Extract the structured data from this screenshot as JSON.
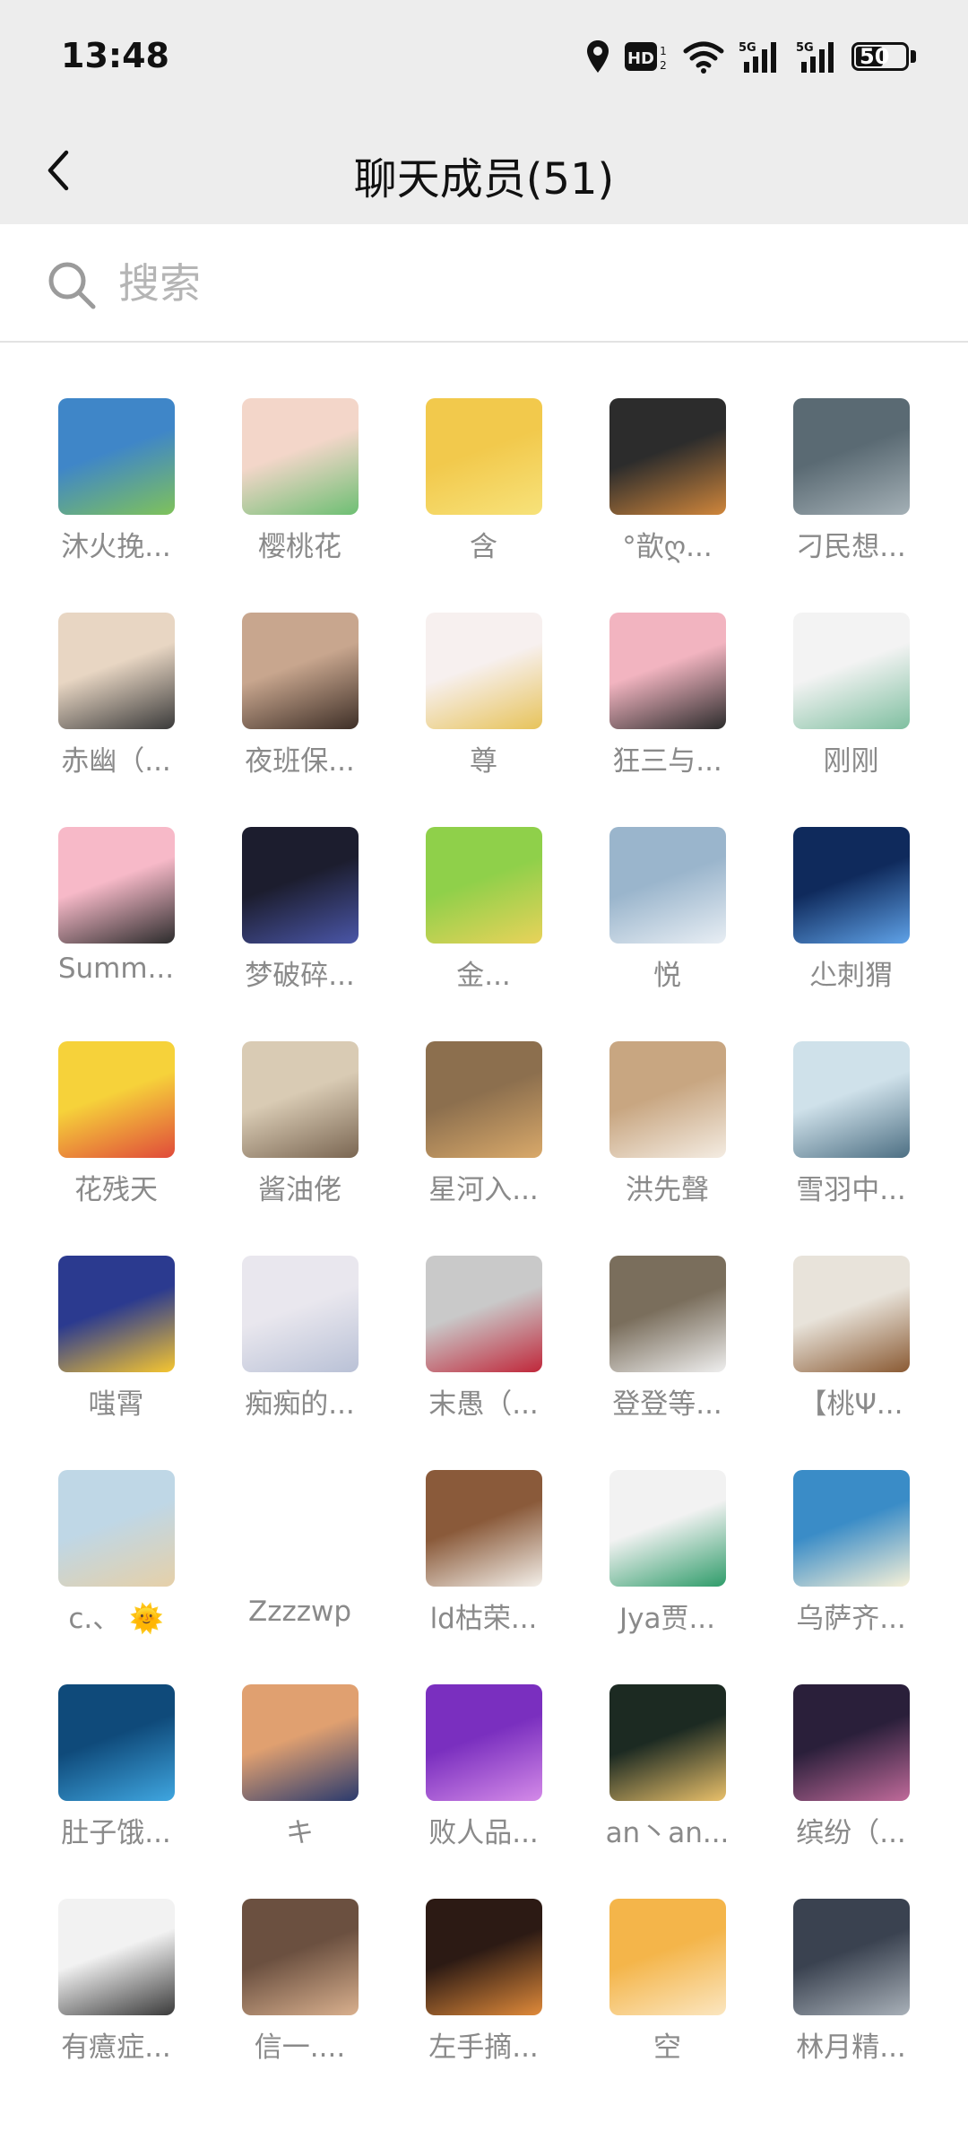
{
  "status_bar": {
    "time": "13:48",
    "battery": "50",
    "icons": [
      "location-icon",
      "hd-icon",
      "wifi-icon",
      "signal-5g-icon",
      "signal-5g-icon",
      "battery-icon"
    ]
  },
  "header": {
    "title": "聊天成员(51)",
    "back_icon": "chevron-left-icon"
  },
  "search": {
    "placeholder": "搜索",
    "value": ""
  },
  "members": [
    {
      "name": "沐火挽...",
      "colors": [
        "#3f86c8",
        "#7fc25a"
      ]
    },
    {
      "name": "樱桃花",
      "colors": [
        "#f3d6c9",
        "#6dbf73"
      ]
    },
    {
      "name": "含",
      "colors": [
        "#f2c94c",
        "#f7e27a"
      ]
    },
    {
      "name": "°歆ღ...",
      "colors": [
        "#2c2c2c",
        "#d0863b"
      ]
    },
    {
      "name": "刁民想...",
      "colors": [
        "#5a6a73",
        "#a4b0b6"
      ]
    },
    {
      "name": "赤幽（...",
      "colors": [
        "#e8d6c3",
        "#3a3a3a"
      ]
    },
    {
      "name": "夜班保...",
      "colors": [
        "#c8a68e",
        "#3e2f27"
      ]
    },
    {
      "name": "尊",
      "colors": [
        "#f7f0ef",
        "#e7c35a"
      ]
    },
    {
      "name": "狂三与...",
      "colors": [
        "#f2b4c0",
        "#2c2c2c"
      ]
    },
    {
      "name": "刚刚",
      "colors": [
        "#f3f3f3",
        "#7fbfa0"
      ]
    },
    {
      "name": "Summ...",
      "colors": [
        "#f7b9c8",
        "#2c2c2c"
      ]
    },
    {
      "name": "梦破碎...",
      "colors": [
        "#1c1d2e",
        "#4a56a8"
      ]
    },
    {
      "name": "金...",
      "colors": [
        "#8fd04a",
        "#e9d25a"
      ]
    },
    {
      "name": "悦",
      "colors": [
        "#9ab5cc",
        "#e8eef4"
      ]
    },
    {
      "name": "尐刺猬",
      "colors": [
        "#0f2a5c",
        "#5fa2e8"
      ]
    },
    {
      "name": "花残天",
      "colors": [
        "#f6d23a",
        "#e04a3a"
      ]
    },
    {
      "name": "酱油佬",
      "colors": [
        "#d9cbb4",
        "#7a6652"
      ]
    },
    {
      "name": "星河入...",
      "colors": [
        "#8c6f4e",
        "#d9a96a"
      ]
    },
    {
      "name": "洪先聲",
      "colors": [
        "#c8a681",
        "#f4ece2"
      ]
    },
    {
      "name": "雪羽中...",
      "colors": [
        "#cfe1ea",
        "#4d6f83"
      ]
    },
    {
      "name": "嗤霄",
      "colors": [
        "#2b3a8f",
        "#f6c630"
      ]
    },
    {
      "name": "痴痴的...",
      "colors": [
        "#e9e7ee",
        "#b9c1d6"
      ]
    },
    {
      "name": "末愚（...",
      "colors": [
        "#c9c9c9",
        "#c0273a"
      ]
    },
    {
      "name": "登登等...",
      "colors": [
        "#7a6e5c",
        "#efefef"
      ]
    },
    {
      "name": "【桃Ψ...",
      "colors": [
        "#e8e3da",
        "#8a5a33"
      ]
    },
    {
      "name": "c.、 🌞",
      "colors": [
        "#bfd7e6",
        "#e6d0a8"
      ]
    },
    {
      "name": "Zzzzwp",
      "colors": [
        "#ffffff",
        "#ffffff"
      ]
    },
    {
      "name": "ld枯荣...",
      "colors": [
        "#8a5a3a",
        "#f4f0ea"
      ]
    },
    {
      "name": "Jya贾...",
      "colors": [
        "#f2f2f2",
        "#2f9c6a"
      ]
    },
    {
      "name": "乌萨齐...",
      "colors": [
        "#3a8cc7",
        "#f7f1d8"
      ]
    },
    {
      "name": "肚子饿...",
      "colors": [
        "#0f4a7a",
        "#3fa6e0"
      ]
    },
    {
      "name": "キ",
      "colors": [
        "#e0a070",
        "#2a3a6e"
      ]
    },
    {
      "name": "败人品...",
      "colors": [
        "#7a2fbf",
        "#d48ae8"
      ]
    },
    {
      "name": "an丶an...",
      "colors": [
        "#1c2a22",
        "#e9c06a"
      ]
    },
    {
      "name": "缤纷（...",
      "colors": [
        "#2a1f3a",
        "#c06a9a"
      ]
    },
    {
      "name": "有癔症...",
      "colors": [
        "#f2f2f2",
        "#3a3a3a"
      ]
    },
    {
      "name": "信一....",
      "colors": [
        "#6b5040",
        "#d9b08e"
      ]
    },
    {
      "name": "左手摘...",
      "colors": [
        "#2c1a14",
        "#e08a3a"
      ]
    },
    {
      "name": "空",
      "colors": [
        "#f4b54a",
        "#fbe6c0"
      ]
    },
    {
      "name": "林月精...",
      "colors": [
        "#3a4250",
        "#a8b0b8"
      ]
    }
  ]
}
